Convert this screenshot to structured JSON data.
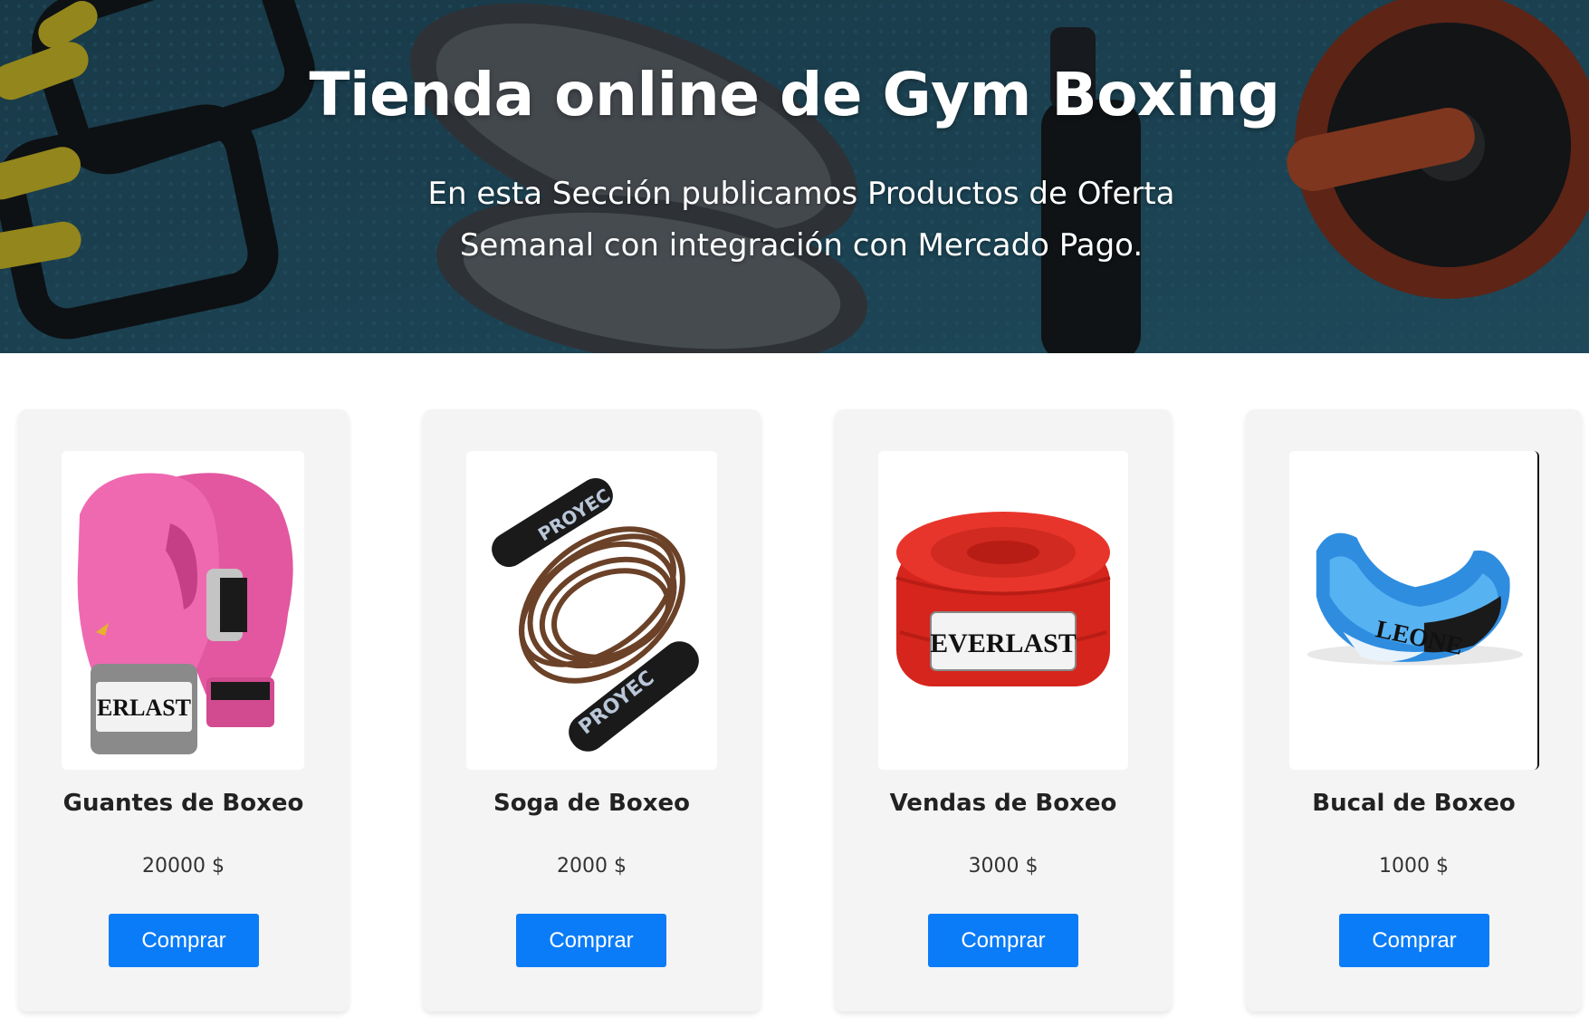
{
  "hero": {
    "title": "Tienda online de Gym Boxing",
    "subtitle": "En esta Sección publicamos Productos de Oferta Semanal con integración con Mercado Pago."
  },
  "products": [
    {
      "name": "Guantes de Boxeo",
      "price": "20000 $",
      "button": "Comprar",
      "image_icon": "boxing-gloves-icon"
    },
    {
      "name": "Soga de Boxeo",
      "price": "2000 $",
      "button": "Comprar",
      "image_icon": "jump-rope-icon"
    },
    {
      "name": "Vendas de Boxeo",
      "price": "3000 $",
      "button": "Comprar",
      "image_icon": "hand-wraps-icon"
    },
    {
      "name": "Bucal de Boxeo",
      "price": "1000 $",
      "button": "Comprar",
      "image_icon": "mouthguard-icon"
    }
  ],
  "colors": {
    "button": "#0a7cf8",
    "card_bg": "#f4f4f4",
    "hero_bg": "#1f4a5c"
  }
}
